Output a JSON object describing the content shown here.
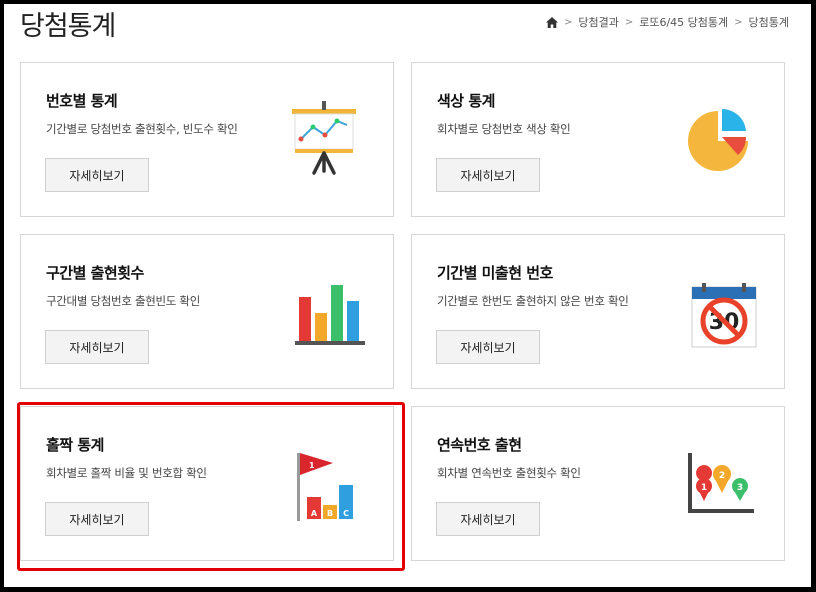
{
  "page": {
    "title": "당첨통계"
  },
  "breadcrumb": {
    "home_icon": "home-icon",
    "items": [
      "당첨결과",
      "로또6/45 당첨통계",
      "당첨통계"
    ]
  },
  "cards": [
    {
      "title": "번호별 통계",
      "desc": "기간별로 당첨번호 출현횟수, 빈도수 확인",
      "button": "자세히보기",
      "icon": "presentation-line-chart-icon"
    },
    {
      "title": "색상 통계",
      "desc": "회차별로 당첨번호 색상 확인",
      "button": "자세히보기",
      "icon": "pie-chart-icon"
    },
    {
      "title": "구간별 출현횟수",
      "desc": "구간대별 당첨번호 출현빈도 확인",
      "button": "자세히보기",
      "icon": "bar-chart-icon"
    },
    {
      "title": "기간별 미출현 번호",
      "desc": "기간별로 한번도 출현하지 않은 번호 확인",
      "button": "자세히보기",
      "icon": "calendar-no-30-icon",
      "icon_text": "30"
    },
    {
      "title": "홀짝 통계",
      "desc": "회차별로 홀짝 비율 및 번호합 확인",
      "button": "자세히보기",
      "icon": "flag-abc-chart-icon",
      "icon_text": [
        "1",
        "A",
        "B",
        "C"
      ]
    },
    {
      "title": "연속번호 출현",
      "desc": "회차별 연속번호 출현횟수 확인",
      "button": "자세히보기",
      "icon": "map-pin-graph-icon",
      "icon_text": [
        "1",
        "2",
        "3"
      ]
    }
  ],
  "colors": {
    "highlight": "#e30000",
    "border": "#d6d6d6",
    "button_bg": "#f3f3f3"
  }
}
